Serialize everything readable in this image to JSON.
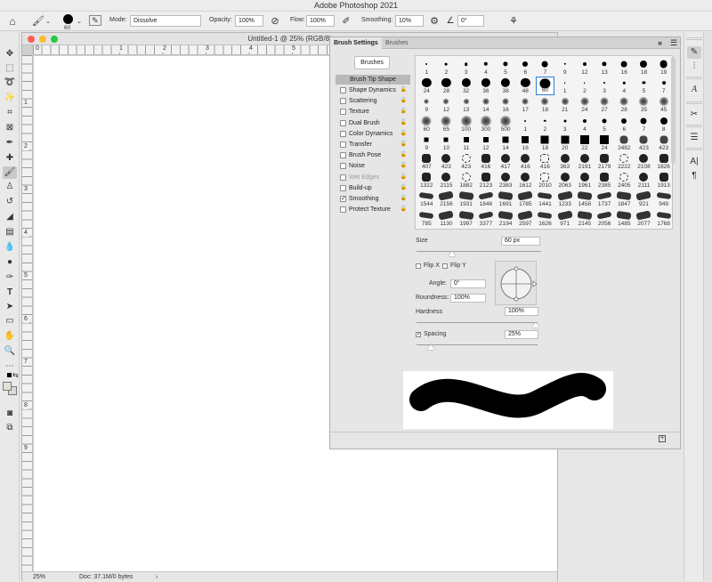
{
  "app": {
    "title": "Adobe Photoshop 2021"
  },
  "options_bar": {
    "brush_size": "60",
    "mode_label": "Mode:",
    "mode_value": "Dissolve",
    "opacity_label": "Opacity:",
    "opacity_value": "100%",
    "flow_label": "Flow:",
    "flow_value": "100%",
    "smoothing_label": "Smoothing:",
    "smoothing_value": "10%",
    "angle_value": "0°"
  },
  "document": {
    "title": "Untitled-1 @ 25% (RGB/8)",
    "zoom": "25%",
    "doc_info": "Doc: 37.1M/0 bytes",
    "ruler_h": [
      "0",
      "1",
      "2",
      "3",
      "4",
      "5",
      "6"
    ],
    "ruler_v": [
      "1",
      "2",
      "3",
      "4",
      "5",
      "6",
      "7",
      "8",
      "9"
    ]
  },
  "panel": {
    "tabs": [
      "Brush Settings",
      "Brushes"
    ],
    "brushes_button": "Brushes",
    "tip_shape": "Brush Tip Shape",
    "options": [
      {
        "label": "Shape Dynamics",
        "checked": false,
        "dim": false
      },
      {
        "label": "Scattering",
        "checked": false,
        "dim": false
      },
      {
        "label": "Texture",
        "checked": false,
        "dim": false
      },
      {
        "label": "Dual Brush",
        "checked": false,
        "dim": false
      },
      {
        "label": "Color Dynamics",
        "checked": false,
        "dim": false
      },
      {
        "label": "Transfer",
        "checked": false,
        "dim": false
      },
      {
        "label": "Brush Pose",
        "checked": false,
        "dim": false
      },
      {
        "label": "Noise",
        "checked": false,
        "dim": false
      },
      {
        "label": "Wet Edges",
        "checked": false,
        "dim": true
      },
      {
        "label": "Build-up",
        "checked": false,
        "dim": false
      },
      {
        "label": "Smoothing",
        "checked": true,
        "dim": false
      },
      {
        "label": "Protect Texture",
        "checked": false,
        "dim": false
      }
    ],
    "brush_rows": [
      {
        "type": "hard",
        "labels": [
          "1",
          "2",
          "3",
          "4",
          "5",
          "6",
          "7",
          "9",
          "12",
          "13",
          "16",
          "18",
          "19"
        ]
      },
      {
        "type": "hard",
        "labels": [
          "24",
          "28",
          "32",
          "36",
          "38",
          "48",
          "60",
          "1",
          "2",
          "3",
          "4",
          "5",
          "7"
        ]
      },
      {
        "type": "soft",
        "labels": [
          "9",
          "12",
          "13",
          "14",
          "16",
          "17",
          "18",
          "21",
          "24",
          "27",
          "28",
          "35",
          "45"
        ]
      },
      {
        "type": "soft",
        "labels": [
          "60",
          "65",
          "100",
          "300",
          "500",
          "1",
          "2",
          "3",
          "4",
          "5",
          "6",
          "7",
          "8"
        ]
      },
      {
        "type": "square",
        "labels": [
          "9",
          "10",
          "11",
          "12",
          "14",
          "16",
          "18",
          "20",
          "22",
          "24",
          "2482",
          "423",
          "423"
        ]
      },
      {
        "type": "splat",
        "labels": [
          "407",
          "423",
          "423",
          "416",
          "417",
          "416",
          "416",
          "363",
          "2191",
          "2179",
          "2222",
          "2108",
          "1826"
        ]
      },
      {
        "type": "splat",
        "labels": [
          "1322",
          "2115",
          "1882",
          "2123",
          "2383",
          "1612",
          "2010",
          "2063",
          "1961",
          "2385",
          "2405",
          "2111",
          "1913"
        ]
      },
      {
        "type": "stroke",
        "labels": [
          "1544",
          "2156",
          "1931",
          "1846",
          "1691",
          "1785",
          "1441",
          "1233",
          "1458",
          "1737",
          "1847",
          "921",
          "949"
        ]
      },
      {
        "type": "stroke",
        "labels": [
          "785",
          "1130",
          "1997",
          "3377",
          "2194",
          "2597",
          "1626",
          "971",
          "2145",
          "2056",
          "1485",
          "2077",
          "1768"
        ]
      }
    ],
    "size_label": "Size",
    "size_value": "60 px",
    "flip_x": "Flip X",
    "flip_y": "Flip Y",
    "angle_label": "Angle:",
    "angle_value": "0°",
    "roundness_label": "Roundness:",
    "roundness_value": "100%",
    "hardness_label": "Hardness",
    "hardness_value": "100%",
    "spacing_label": "Spacing",
    "spacing_value": "25%"
  },
  "colors": {
    "foreground": "#000000",
    "background": "#d9d9d9"
  }
}
